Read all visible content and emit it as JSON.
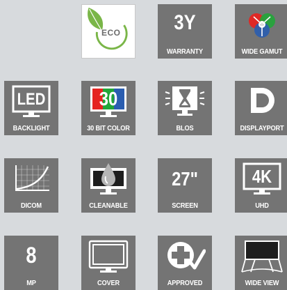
{
  "features": [
    {
      "id": "eco",
      "label": "ECO",
      "icon": "eco-leaf-icon"
    },
    {
      "id": "warranty",
      "value": "3Y",
      "label": "WARRANTY",
      "icon": "warranty-icon"
    },
    {
      "id": "wide-gamut",
      "label": "WIDE GAMUT",
      "icon": "rgb-circles-icon"
    },
    {
      "id": "backlight",
      "value": "LED",
      "label": "BACKLIGHT",
      "icon": "led-monitor-icon"
    },
    {
      "id": "color",
      "value": "30",
      "label": "30 BIT COLOR",
      "icon": "color-monitor-icon"
    },
    {
      "id": "blos",
      "label": "BLOS",
      "icon": "hourglass-monitor-icon"
    },
    {
      "id": "displayport",
      "label": "DISPLAYPORT",
      "icon": "displayport-icon"
    },
    {
      "id": "dicom",
      "label": "DICOM",
      "icon": "dicom-curve-icon"
    },
    {
      "id": "cleanable",
      "label": "CLEANABLE",
      "icon": "droplet-monitor-icon"
    },
    {
      "id": "screen",
      "value": "27\"",
      "label": "SCREEN",
      "icon": "screen-size-icon"
    },
    {
      "id": "uhd",
      "value": "4K",
      "label": "UHD",
      "icon": "uhd-monitor-icon"
    },
    {
      "id": "mp",
      "value": "8",
      "label": "MP",
      "icon": "megapixel-icon"
    },
    {
      "id": "cover",
      "label": "COVER",
      "icon": "cover-monitor-icon"
    },
    {
      "id": "approved",
      "label": "APPROVED",
      "icon": "medical-approved-icon"
    },
    {
      "id": "wideview",
      "label": "WIDE VIEW",
      "icon": "wide-view-icon"
    }
  ],
  "colors": {
    "tile_bg": "#747474",
    "page_bg": "#d7dadd",
    "eco_green": "#7ab648",
    "red": "#e52421",
    "green": "#22a639",
    "blue": "#2a5db0"
  }
}
